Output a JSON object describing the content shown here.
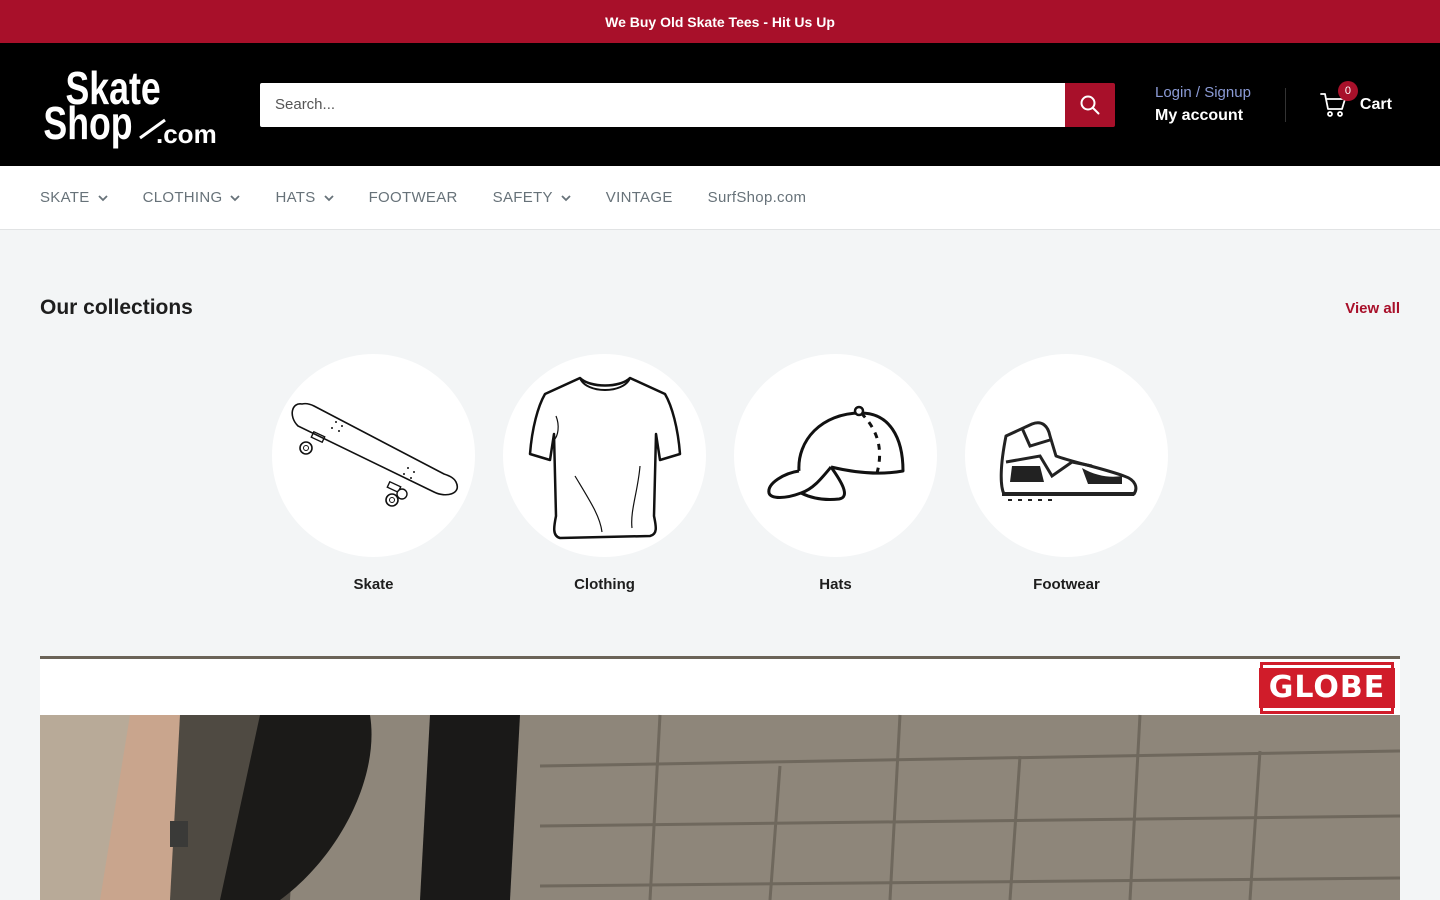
{
  "announcement": "We Buy Old Skate Tees - Hit Us Up",
  "logo": {
    "line1": "Skate",
    "line2": "Shop",
    "line3": ".com"
  },
  "search": {
    "placeholder": "Search..."
  },
  "account": {
    "login": "Login / Signup",
    "my_account": "My account"
  },
  "cart": {
    "label": "Cart",
    "count": "0"
  },
  "nav": [
    {
      "label": "SKATE",
      "dropdown": true
    },
    {
      "label": "CLOTHING",
      "dropdown": true
    },
    {
      "label": "HATS",
      "dropdown": true
    },
    {
      "label": "FOOTWEAR",
      "dropdown": false
    },
    {
      "label": "SAFETY",
      "dropdown": true
    },
    {
      "label": "VINTAGE",
      "dropdown": false
    },
    {
      "label": "SurfShop.com",
      "dropdown": false
    }
  ],
  "collections": {
    "title": "Our collections",
    "view_all": "View all",
    "items": [
      {
        "label": "Skate",
        "icon": "skateboard-icon"
      },
      {
        "label": "Clothing",
        "icon": "tshirt-icon"
      },
      {
        "label": "Hats",
        "icon": "cap-icon"
      },
      {
        "label": "Footwear",
        "icon": "sneaker-icon"
      }
    ]
  },
  "banner": {
    "brand": "GLOBE"
  },
  "colors": {
    "accent": "#a8102a",
    "header_bg": "#000000",
    "nav_text": "#677279",
    "page_bg": "#f3f5f6"
  }
}
